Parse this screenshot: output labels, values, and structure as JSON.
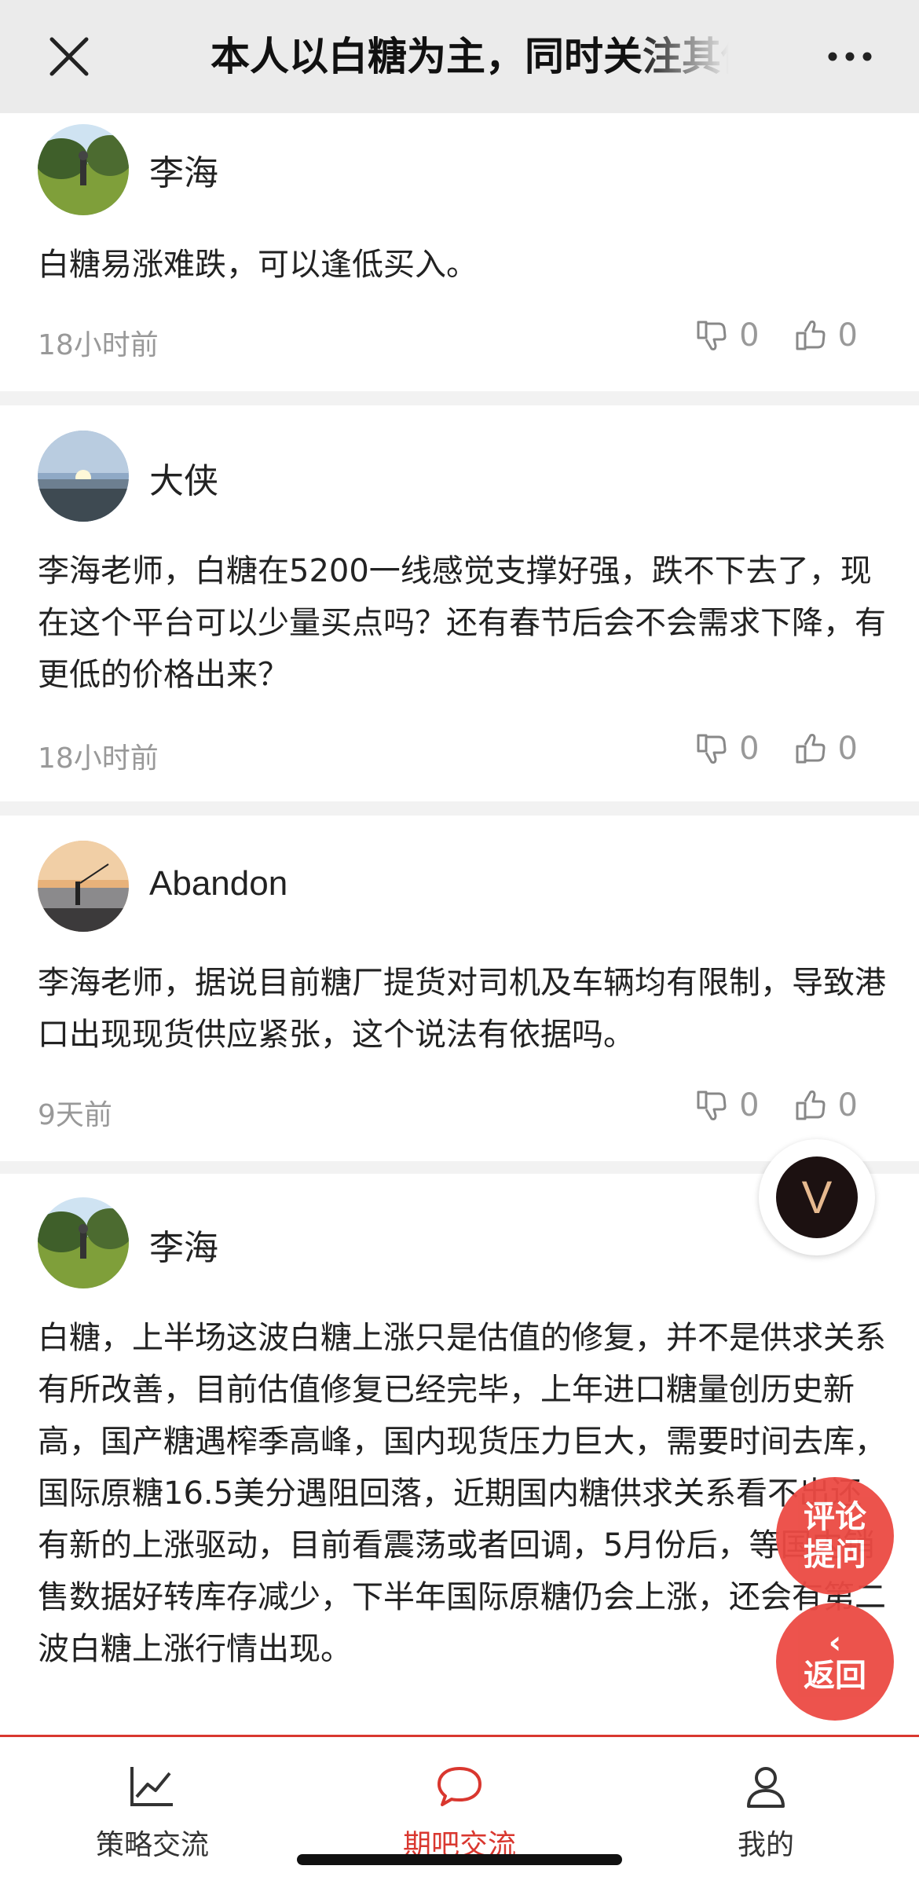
{
  "header": {
    "title": "本人以白糖为主，同时关注其他品种"
  },
  "comments": [
    {
      "user": "李海",
      "avatar": "golf-avatar",
      "text": "白糖易涨难跌，可以逢低买入。",
      "time": "18小时前",
      "down": "0",
      "up": "0"
    },
    {
      "user": "大侠",
      "avatar": "lake-sunset-avatar",
      "text": "李海老师，白糖在5200一线感觉支撑好强，跌不下去了，现在这个平台可以少量买点吗？还有春节后会不会需求下降，有更低的价格出来？",
      "time": "18小时前",
      "down": "0",
      "up": "0"
    },
    {
      "user": "Abandon",
      "avatar": "fishing-sunset-avatar",
      "text": "李海老师，据说目前糖厂提货对司机及车辆均有限制，导致港口出现现货供应紧张，这个说法有依据吗。",
      "time": "9天前",
      "down": "0",
      "up": "0"
    },
    {
      "user": "李海",
      "avatar": "golf-avatar",
      "text": "白糖，上半场这波白糖上涨只是估值的修复，并不是供求关系有所改善，目前估值修复已经完毕，上年进口糖量创历史新高，国产糖遇榨季高峰，国内现货压力巨大，需要时间去库，国际原糖16.5美分遇阻回落，近期国内糖供求关系看不出还有新的上涨驱动，目前看震荡或者回调，5月份后，等国内销售数据好转库存减少，下半年国际原糖仍会上涨，还会有第二波白糖上涨行情出现。"
    }
  ],
  "floating": {
    "v_label": "V",
    "ask_line1": "评论",
    "ask_line2": "提问",
    "back_chevron": "‹",
    "back_label": "返回"
  },
  "tabs": [
    {
      "label": "策略交流",
      "icon": "chart-line-icon"
    },
    {
      "label": "期吧交流",
      "icon": "chat-bubble-icon",
      "active": true
    },
    {
      "label": "我的",
      "icon": "user-icon"
    }
  ],
  "colors": {
    "accent": "#d9372f",
    "fab": "#ec4a43",
    "muted": "#999999"
  }
}
